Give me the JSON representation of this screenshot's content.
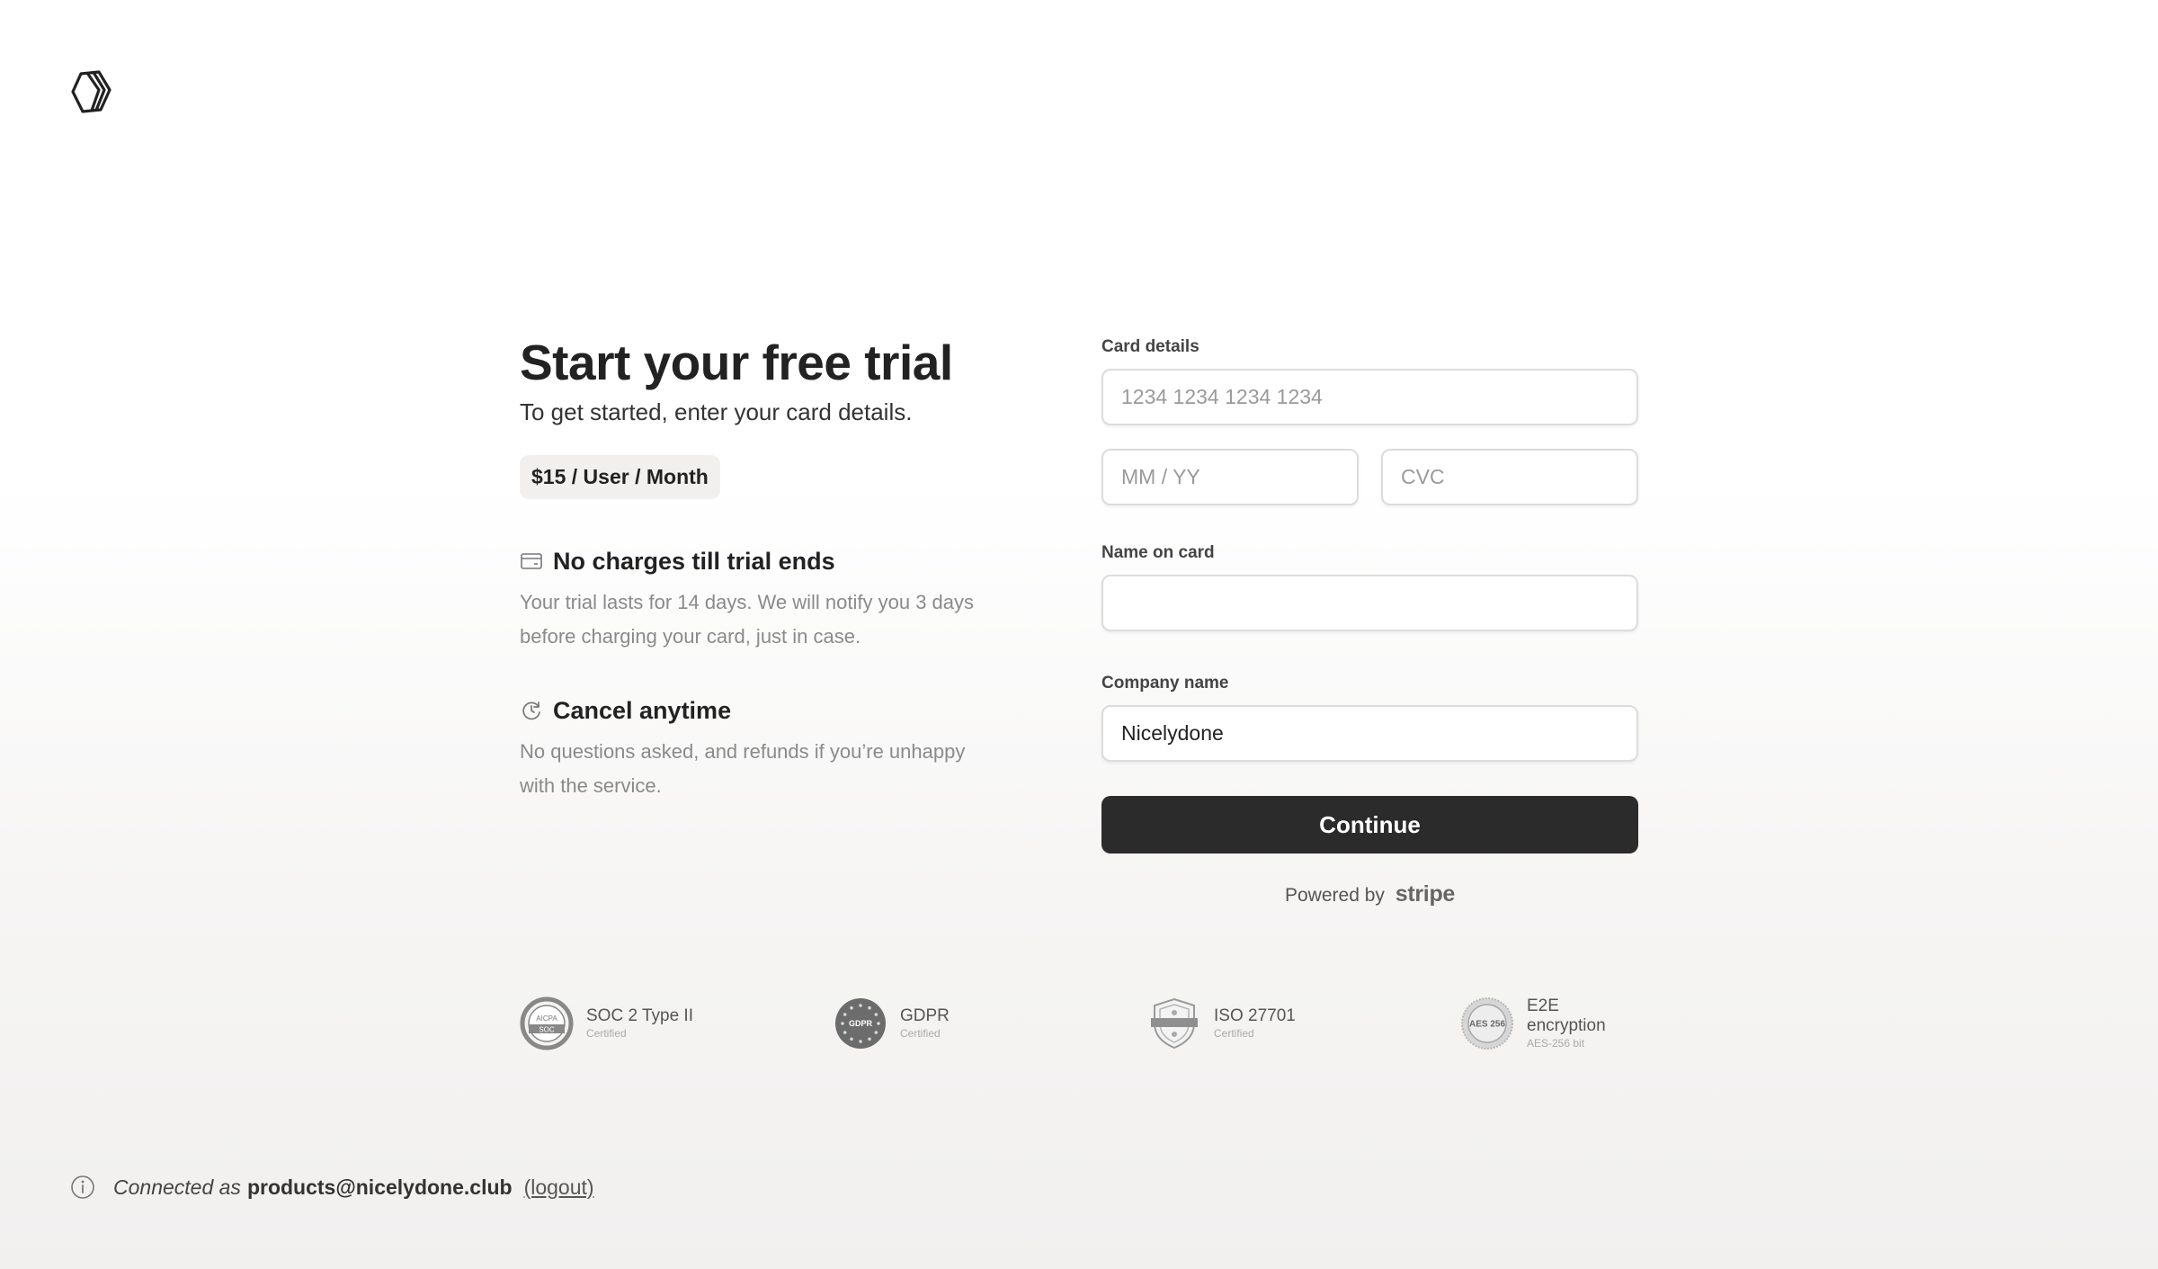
{
  "brand": {
    "logo_icon": "hexagon-logo-icon"
  },
  "intro": {
    "title": "Start your free trial",
    "subtitle": "To get started, enter your card details.",
    "price": "$15 / User / Month"
  },
  "features": [
    {
      "icon": "credit-card-icon",
      "title": "No charges till trial ends",
      "text": "Your trial lasts for 14 days. We will notify you 3 days before charging your card, just in case."
    },
    {
      "icon": "refresh-clock-icon",
      "title": "Cancel anytime",
      "text": "No questions asked, and refunds if you’re unhappy with the service."
    }
  ],
  "form": {
    "card_label": "Card details",
    "card_number_placeholder": "1234 1234 1234 1234",
    "card_number_value": "",
    "expiry_placeholder": "MM / YY",
    "expiry_value": "",
    "cvc_placeholder": "CVC",
    "cvc_value": "",
    "name_label": "Name on card",
    "name_value": "",
    "company_label": "Company name",
    "company_value": "Nicelydone",
    "continue_label": "Continue",
    "powered_by": "Powered by",
    "stripe_label": "stripe"
  },
  "badges": [
    {
      "icon": "aicpa-soc-seal-icon",
      "name": "SOC 2 Type II",
      "sub": "Certified"
    },
    {
      "icon": "gdpr-seal-icon",
      "name": "GDPR",
      "sub": "Certified"
    },
    {
      "icon": "iso-shield-icon",
      "name": "ISO 27701",
      "sub": "Certified"
    },
    {
      "icon": "aes-256-seal-icon",
      "name": "E2E encryption",
      "sub": "AES-256 bit"
    }
  ],
  "footer": {
    "info_icon": "info-icon",
    "connected_as": "Connected as",
    "email": "products@nicelydone.club",
    "logout": "(logout)"
  },
  "colors": {
    "primary_button": "#2b2b2b",
    "price_badge_bg": "#f1f0ef",
    "muted_text": "#8a8a8a"
  }
}
